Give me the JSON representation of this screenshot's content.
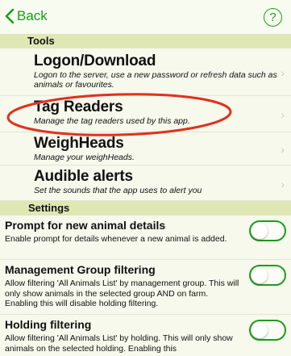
{
  "navbar": {
    "back_label": "Back",
    "help_label": "?"
  },
  "sections": {
    "tools": "Tools",
    "settings": "Settings"
  },
  "tools": [
    {
      "title": "Logon/Download",
      "description": "Logon to the server, use a new password or refresh data such as animals or favourites."
    },
    {
      "title": "Tag Readers",
      "description": "Manage the tag readers used by this app."
    },
    {
      "title": "WeighHeads",
      "description": "Manage your weighHeads."
    },
    {
      "title": "Audible alerts",
      "description": "Set the sounds that the app uses to alert you"
    }
  ],
  "settings": [
    {
      "title": "Prompt for new animal details",
      "description": "Enable prompt for details whenever a new animal is added.",
      "enabled": false
    },
    {
      "title": "Management Group filtering",
      "description": "Allow filtering 'All Animals List' by management group. This will only show animals in the selected group AND on farm. Enabling this will disable holding filtering.",
      "enabled": false
    },
    {
      "title": "Holding filtering",
      "description": "Allow filtering 'All Animals List' by holding. This will only show animals on the selected holding. Enabling this",
      "enabled": false
    }
  ],
  "annotation": {
    "color": "#e0311f"
  },
  "colors": {
    "accent": "#1e9b1e",
    "section_bg": "#dfe8b4"
  }
}
